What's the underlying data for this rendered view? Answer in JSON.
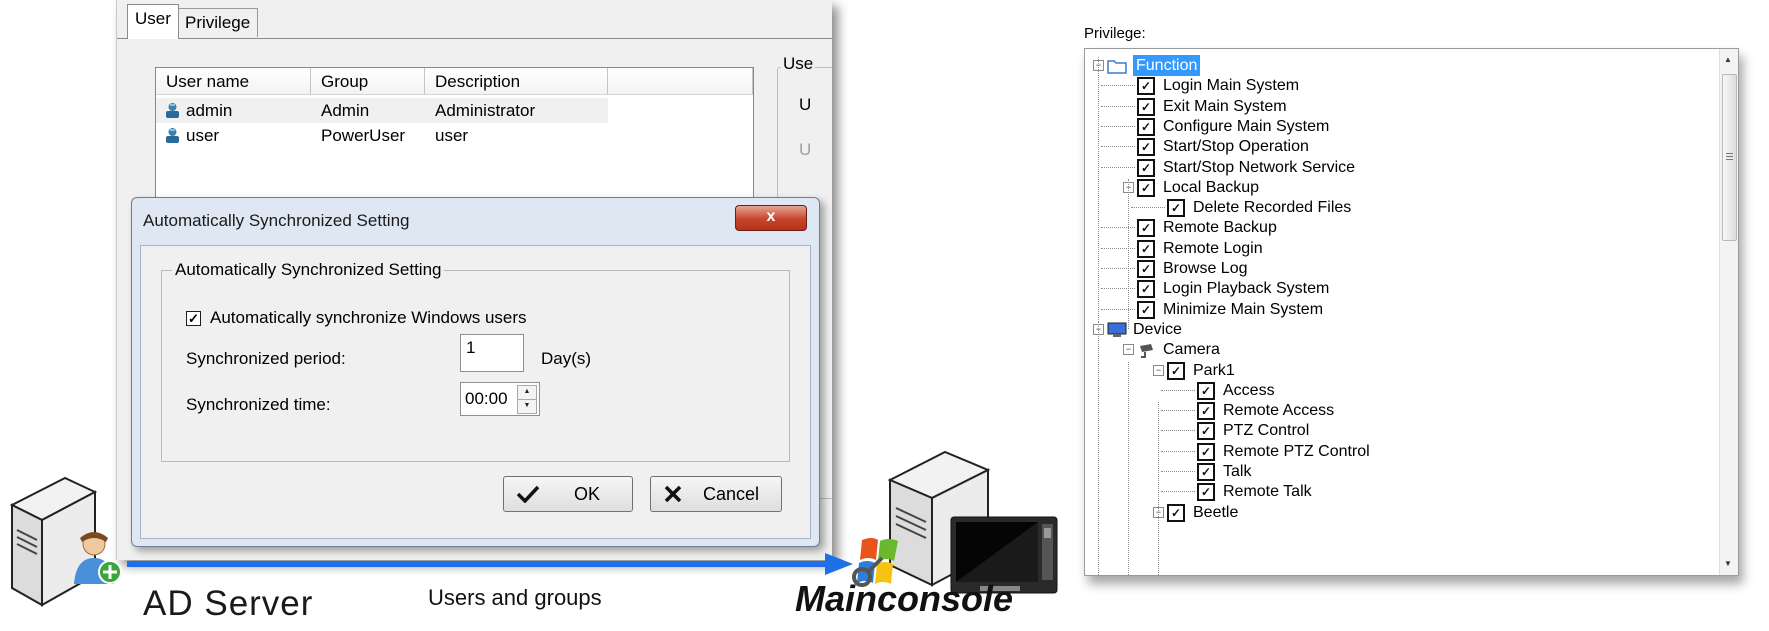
{
  "user_window": {
    "tabs": [
      "User",
      "Privilege"
    ],
    "columns": [
      "User name",
      "Group",
      "Description"
    ],
    "rows": [
      {
        "name": "admin",
        "group": "Admin",
        "description": "Administrator"
      },
      {
        "name": "user",
        "group": "PowerUser",
        "description": "user"
      }
    ],
    "right_group_label": "Use",
    "right_labels": [
      "U",
      "U"
    ]
  },
  "dialog": {
    "title": "Automatically Synchronized Setting",
    "close": "x",
    "group_title": "Automatically Synchronized Setting",
    "checkbox_label": "Automatically synchronize Windows users",
    "checkbox_checked": true,
    "period_label": "Synchronized period:",
    "period_value": "1",
    "period_unit": "Day(s)",
    "time_label": "Synchronized time:",
    "time_value": "00:00",
    "ok_label": "OK",
    "cancel_label": "Cancel"
  },
  "diagram": {
    "ad_label": "AD Server",
    "flow_label": "Users and groups",
    "mainconsole_label": "Mainconsole",
    "arrow_color": "#1f6fe6"
  },
  "privilege_tree": {
    "title": "Privilege:",
    "nodes": [
      "Function",
      "Login Main System",
      "Exit Main System",
      "Configure Main System",
      "Start/Stop Operation",
      "Start/Stop Network Service",
      "Local Backup",
      "Delete Recorded Files",
      "Remote Backup",
      "Remote Login",
      "Browse Log",
      "Login Playback System",
      "Minimize Main System",
      "Device",
      "Camera",
      "Park1",
      "Access",
      "Remote Access",
      "PTZ Control",
      "Remote PTZ Control",
      "Talk",
      "Remote Talk",
      "Beetle"
    ]
  }
}
